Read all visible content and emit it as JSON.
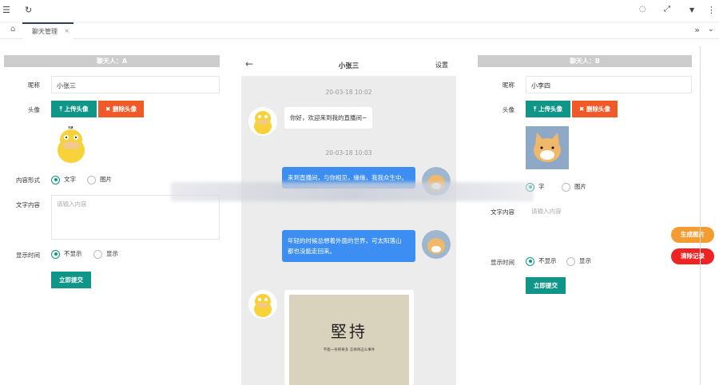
{
  "topbar": {
    "menu_icon": "hamburger-icon",
    "refresh_icon": "refresh-icon",
    "tab_label": "聊天管理",
    "tab_close": "×",
    "home_icon": "home-icon",
    "right_icons": [
      "theme-icon",
      "fullscreen-icon",
      "dropdown-icon",
      "more-icon"
    ],
    "scroll_arrows": "»",
    "scroll_chevron": "⌄"
  },
  "left": {
    "header": "聊天人：A",
    "nickname_label": "昵称",
    "nickname_value": "小张三",
    "avatar_label": "头像",
    "upload_btn": "⤒ 上传头像",
    "delete_btn": "✖ 删除头像",
    "content_type_label": "内容形式",
    "type_text": "文字",
    "type_image": "图片",
    "text_content_label": "文字内容",
    "text_placeholder": "请输入内容",
    "show_time_label": "显示时间",
    "hide_opt": "不显示",
    "show_opt": "显示",
    "submit": "立即提交"
  },
  "chat": {
    "back": "←",
    "title": "小张三",
    "settings": "设置",
    "time1": "20-03-18 10:02",
    "msg1": "你好，欢迎来到我的直播间~",
    "time2": "20-03-18 10:03",
    "msg2": "来到直播间，与你相见，緣缘，我我众生中。",
    "msg3_line1": "年轻的时候总想着外面的世界，可太阳落山",
    "msg3_line2": "都也没能走回来。",
    "card_title": "堅持",
    "card_sub": "不能一条称奇多 怎样将这么事件"
  },
  "right": {
    "header": "聊天人：B",
    "nickname_label": "昵称",
    "nickname_value": "小李四",
    "avatar_label": "头像",
    "upload_btn": "⤒ 上传头像",
    "delete_btn": "✖ 删除头像",
    "type_text": "字",
    "type_image": "图片",
    "text_content_label": "文字内容",
    "text_placeholder": "请输入内容",
    "show_time_label": "显示时间",
    "hide_opt": "不显示",
    "show_opt": "显示",
    "submit": "立即提交"
  },
  "float": {
    "generate": "生成图片",
    "clear": "清除记录"
  },
  "colors": {
    "teal": "#0f9688",
    "orange": "#f05a29",
    "blue_bubble": "#3d8ef2",
    "float_orange": "#f39c32",
    "float_red": "#ee2424"
  }
}
